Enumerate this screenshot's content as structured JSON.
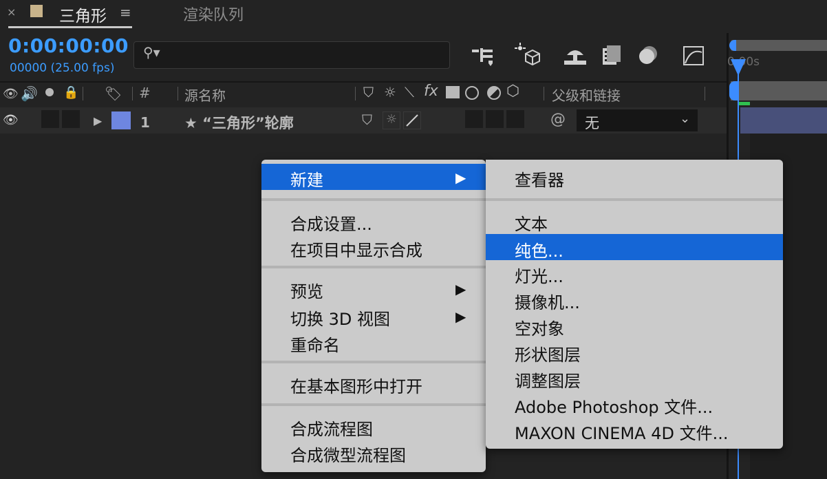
{
  "tabs": {
    "close_glyph": "×",
    "composition_title": "三角形",
    "menu_glyph": "≡",
    "render_queue": "渲染队列",
    "swatch_color": "#c8b38a"
  },
  "toolbar": {
    "timecode": "0:00:00:00",
    "fps": "00000 (25.00 fps)",
    "search_glyph": "⚲▾"
  },
  "columns": {
    "number": "#",
    "source_name": "源名称",
    "parent_link": "父级和链接",
    "fx": "fx"
  },
  "layer": {
    "number": "1",
    "name": "★ “三角形”轮廓",
    "color": "#6e86e0",
    "parent_value": "无",
    "expand_glyph": "▶",
    "parent_chevron": "⌄",
    "pickwhip_glyph": "@"
  },
  "timeline": {
    "time_label": "0:00s"
  },
  "context_menu": {
    "items": [
      {
        "label": "新建",
        "has_submenu": true,
        "highlighted": true
      },
      {
        "label": "合成设置..."
      },
      {
        "label": "在项目中显示合成"
      },
      {
        "label": "预览",
        "has_submenu": true
      },
      {
        "label": "切换 3D 视图",
        "has_submenu": true
      },
      {
        "label": "重命名"
      },
      {
        "label": "在基本图形中打开"
      },
      {
        "label": "合成流程图"
      },
      {
        "label": "合成微型流程图"
      }
    ],
    "submenu_arrow": "▶"
  },
  "submenu": {
    "items": [
      {
        "label": "查看器"
      },
      {
        "label": "文本"
      },
      {
        "label": "纯色...",
        "highlighted": true
      },
      {
        "label": "灯光..."
      },
      {
        "label": "摄像机..."
      },
      {
        "label": "空对象"
      },
      {
        "label": "形状图层"
      },
      {
        "label": "调整图层"
      },
      {
        "label": "Adobe Photoshop 文件..."
      },
      {
        "label": "MAXON CINEMA 4D 文件..."
      }
    ]
  },
  "colors": {
    "accent_blue": "#3c9cff",
    "menu_highlight": "#1566d6",
    "menu_bg": "#cbcbcb"
  }
}
